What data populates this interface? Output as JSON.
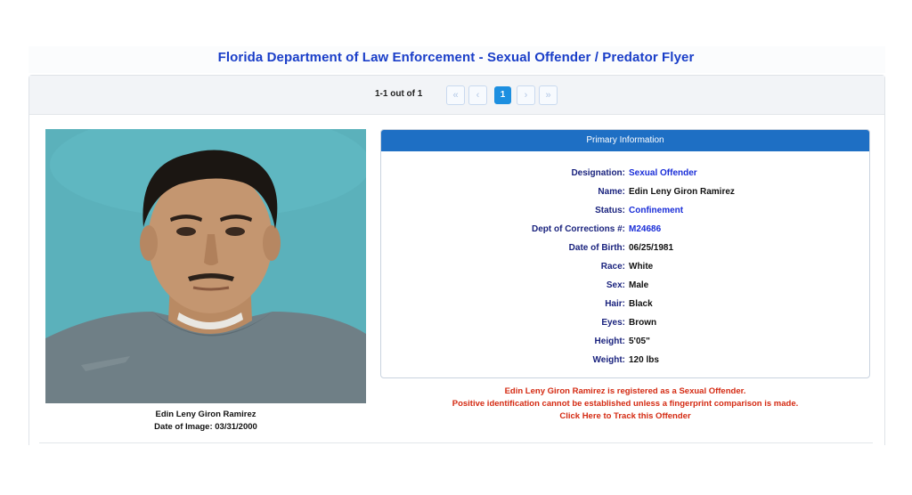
{
  "header": {
    "title": "Florida Department of Law Enforcement - Sexual Offender / Predator Flyer"
  },
  "pager": {
    "count_text": "1-1 out of 1",
    "first_icon": "double-chevron-left-icon",
    "prev_icon": "chevron-left-icon",
    "current_page": "1",
    "next_icon": "chevron-right-icon",
    "last_icon": "double-chevron-right-icon"
  },
  "photo": {
    "name": "Edin Leny Giron Ramirez",
    "date_of_image": "Date of Image: 03/31/2000"
  },
  "primary_info": {
    "header": "Primary Information",
    "fields": [
      {
        "label": "Designation:",
        "value": "Sexual Offender"
      },
      {
        "label": "Name:",
        "value": "Edin Leny Giron Ramirez"
      },
      {
        "label": "Status:",
        "value": "Confinement"
      },
      {
        "label": "Dept of Corrections #:",
        "value": "M24686"
      },
      {
        "label": "Date of Birth:",
        "value": "06/25/1981"
      },
      {
        "label": "Race:",
        "value": "White"
      },
      {
        "label": "Sex:",
        "value": "Male"
      },
      {
        "label": "Hair:",
        "value": "Black"
      },
      {
        "label": "Eyes:",
        "value": "Brown"
      },
      {
        "label": "Height:",
        "value": "5'05\""
      },
      {
        "label": "Weight:",
        "value": "120 lbs"
      }
    ]
  },
  "notice": {
    "line1": "Edin Leny Giron Ramirez is registered as a Sexual Offender.",
    "line2": "Positive identification cannot be established unless a fingerprint comparison is made.",
    "track_link": "Click Here to Track this Offender"
  },
  "colors": {
    "title": "#1a3ec8",
    "header_bar": "#1e6fc4",
    "pager_active": "#1d8fe0",
    "notice_red": "#d42a12"
  }
}
